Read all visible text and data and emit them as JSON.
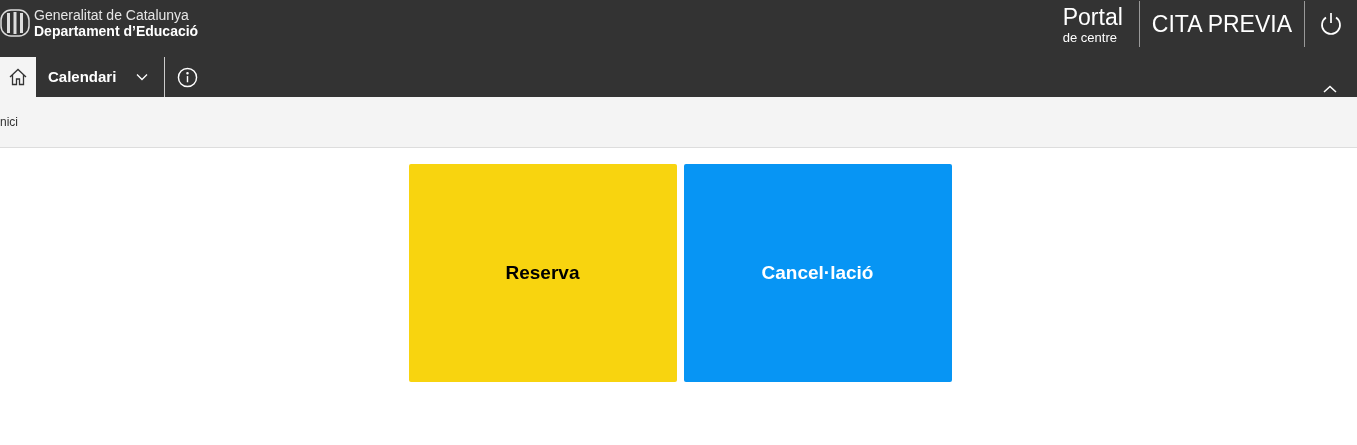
{
  "header": {
    "org_line1": "Generalitat de Catalunya",
    "org_line2": "Departament d’Educació",
    "portal_title": "Portal",
    "portal_subtitle": "de centre",
    "app_title": "CITA PREVIA"
  },
  "nav": {
    "items": [
      {
        "kind": "home",
        "selected": true
      },
      {
        "kind": "menu",
        "label": "Calendari",
        "selected": false
      },
      {
        "kind": "info",
        "selected": false
      }
    ],
    "expanded": true
  },
  "breadcrumb": "nici",
  "tiles": [
    {
      "label": "Reserva",
      "color": "#f8d40f"
    },
    {
      "label": "Cancel·lació",
      "color": "#0795f4"
    }
  ]
}
